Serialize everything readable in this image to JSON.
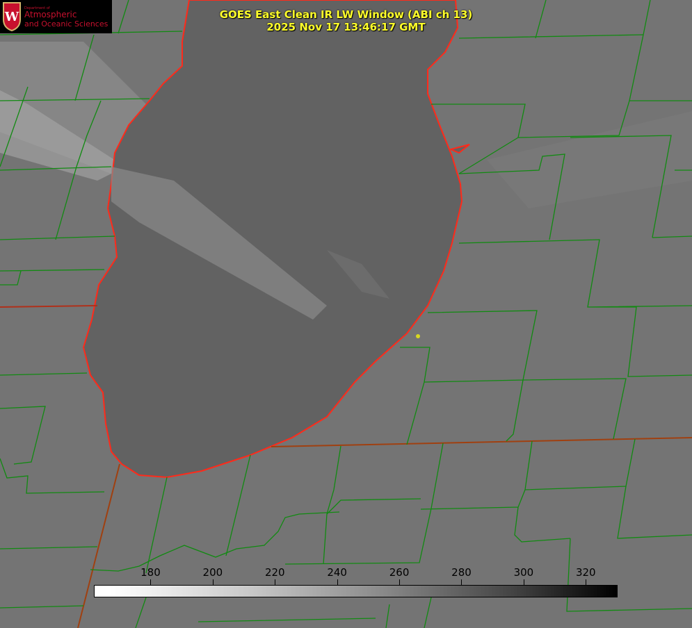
{
  "title": {
    "line1": "GOES East Clean IR LW Window (ABI ch 13)",
    "line2": "2025 Nov 17 13:46:17 GMT"
  },
  "logo": {
    "dept": "Department of",
    "line1": "Atmospheric",
    "line2": "and Oceanic Sciences",
    "crest_letter": "W"
  },
  "colorbar": {
    "ticks": [
      "180",
      "200",
      "220",
      "240",
      "260",
      "280",
      "300",
      "320"
    ],
    "tick_values": [
      180,
      200,
      220,
      240,
      260,
      280,
      300,
      320
    ],
    "range": [
      162,
      330
    ],
    "colormap": "white-to-black (brightness temperature K)"
  },
  "colors": {
    "title": "#ffff2a",
    "shoreline": "#ff2a1a",
    "county_lines": "#118a11",
    "marker": "#d8d820"
  }
}
